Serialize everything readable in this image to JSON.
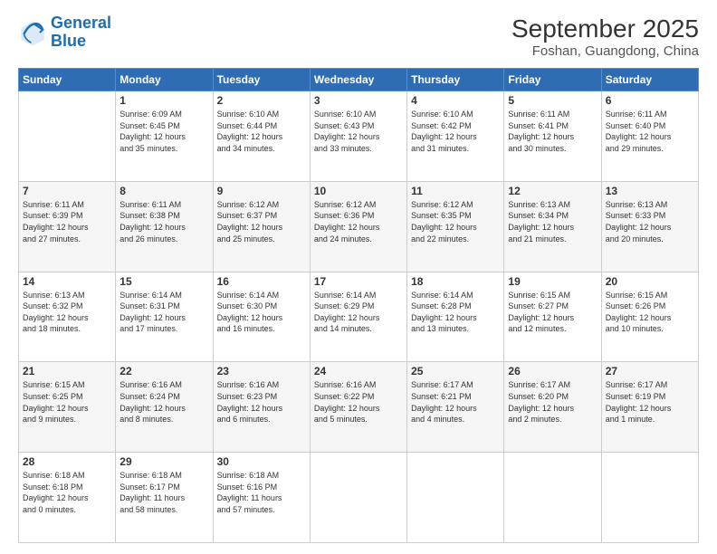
{
  "header": {
    "logo_line1": "General",
    "logo_line2": "Blue",
    "title": "September 2025",
    "subtitle": "Foshan, Guangdong, China"
  },
  "weekdays": [
    "Sunday",
    "Monday",
    "Tuesday",
    "Wednesday",
    "Thursday",
    "Friday",
    "Saturday"
  ],
  "weeks": [
    [
      {
        "day": "",
        "text": ""
      },
      {
        "day": "1",
        "text": "Sunrise: 6:09 AM\nSunset: 6:45 PM\nDaylight: 12 hours\nand 35 minutes."
      },
      {
        "day": "2",
        "text": "Sunrise: 6:10 AM\nSunset: 6:44 PM\nDaylight: 12 hours\nand 34 minutes."
      },
      {
        "day": "3",
        "text": "Sunrise: 6:10 AM\nSunset: 6:43 PM\nDaylight: 12 hours\nand 33 minutes."
      },
      {
        "day": "4",
        "text": "Sunrise: 6:10 AM\nSunset: 6:42 PM\nDaylight: 12 hours\nand 31 minutes."
      },
      {
        "day": "5",
        "text": "Sunrise: 6:11 AM\nSunset: 6:41 PM\nDaylight: 12 hours\nand 30 minutes."
      },
      {
        "day": "6",
        "text": "Sunrise: 6:11 AM\nSunset: 6:40 PM\nDaylight: 12 hours\nand 29 minutes."
      }
    ],
    [
      {
        "day": "7",
        "text": "Sunrise: 6:11 AM\nSunset: 6:39 PM\nDaylight: 12 hours\nand 27 minutes."
      },
      {
        "day": "8",
        "text": "Sunrise: 6:11 AM\nSunset: 6:38 PM\nDaylight: 12 hours\nand 26 minutes."
      },
      {
        "day": "9",
        "text": "Sunrise: 6:12 AM\nSunset: 6:37 PM\nDaylight: 12 hours\nand 25 minutes."
      },
      {
        "day": "10",
        "text": "Sunrise: 6:12 AM\nSunset: 6:36 PM\nDaylight: 12 hours\nand 24 minutes."
      },
      {
        "day": "11",
        "text": "Sunrise: 6:12 AM\nSunset: 6:35 PM\nDaylight: 12 hours\nand 22 minutes."
      },
      {
        "day": "12",
        "text": "Sunrise: 6:13 AM\nSunset: 6:34 PM\nDaylight: 12 hours\nand 21 minutes."
      },
      {
        "day": "13",
        "text": "Sunrise: 6:13 AM\nSunset: 6:33 PM\nDaylight: 12 hours\nand 20 minutes."
      }
    ],
    [
      {
        "day": "14",
        "text": "Sunrise: 6:13 AM\nSunset: 6:32 PM\nDaylight: 12 hours\nand 18 minutes."
      },
      {
        "day": "15",
        "text": "Sunrise: 6:14 AM\nSunset: 6:31 PM\nDaylight: 12 hours\nand 17 minutes."
      },
      {
        "day": "16",
        "text": "Sunrise: 6:14 AM\nSunset: 6:30 PM\nDaylight: 12 hours\nand 16 minutes."
      },
      {
        "day": "17",
        "text": "Sunrise: 6:14 AM\nSunset: 6:29 PM\nDaylight: 12 hours\nand 14 minutes."
      },
      {
        "day": "18",
        "text": "Sunrise: 6:14 AM\nSunset: 6:28 PM\nDaylight: 12 hours\nand 13 minutes."
      },
      {
        "day": "19",
        "text": "Sunrise: 6:15 AM\nSunset: 6:27 PM\nDaylight: 12 hours\nand 12 minutes."
      },
      {
        "day": "20",
        "text": "Sunrise: 6:15 AM\nSunset: 6:26 PM\nDaylight: 12 hours\nand 10 minutes."
      }
    ],
    [
      {
        "day": "21",
        "text": "Sunrise: 6:15 AM\nSunset: 6:25 PM\nDaylight: 12 hours\nand 9 minutes."
      },
      {
        "day": "22",
        "text": "Sunrise: 6:16 AM\nSunset: 6:24 PM\nDaylight: 12 hours\nand 8 minutes."
      },
      {
        "day": "23",
        "text": "Sunrise: 6:16 AM\nSunset: 6:23 PM\nDaylight: 12 hours\nand 6 minutes."
      },
      {
        "day": "24",
        "text": "Sunrise: 6:16 AM\nSunset: 6:22 PM\nDaylight: 12 hours\nand 5 minutes."
      },
      {
        "day": "25",
        "text": "Sunrise: 6:17 AM\nSunset: 6:21 PM\nDaylight: 12 hours\nand 4 minutes."
      },
      {
        "day": "26",
        "text": "Sunrise: 6:17 AM\nSunset: 6:20 PM\nDaylight: 12 hours\nand 2 minutes."
      },
      {
        "day": "27",
        "text": "Sunrise: 6:17 AM\nSunset: 6:19 PM\nDaylight: 12 hours\nand 1 minute."
      }
    ],
    [
      {
        "day": "28",
        "text": "Sunrise: 6:18 AM\nSunset: 6:18 PM\nDaylight: 12 hours\nand 0 minutes."
      },
      {
        "day": "29",
        "text": "Sunrise: 6:18 AM\nSunset: 6:17 PM\nDaylight: 11 hours\nand 58 minutes."
      },
      {
        "day": "30",
        "text": "Sunrise: 6:18 AM\nSunset: 6:16 PM\nDaylight: 11 hours\nand 57 minutes."
      },
      {
        "day": "",
        "text": ""
      },
      {
        "day": "",
        "text": ""
      },
      {
        "day": "",
        "text": ""
      },
      {
        "day": "",
        "text": ""
      }
    ]
  ]
}
